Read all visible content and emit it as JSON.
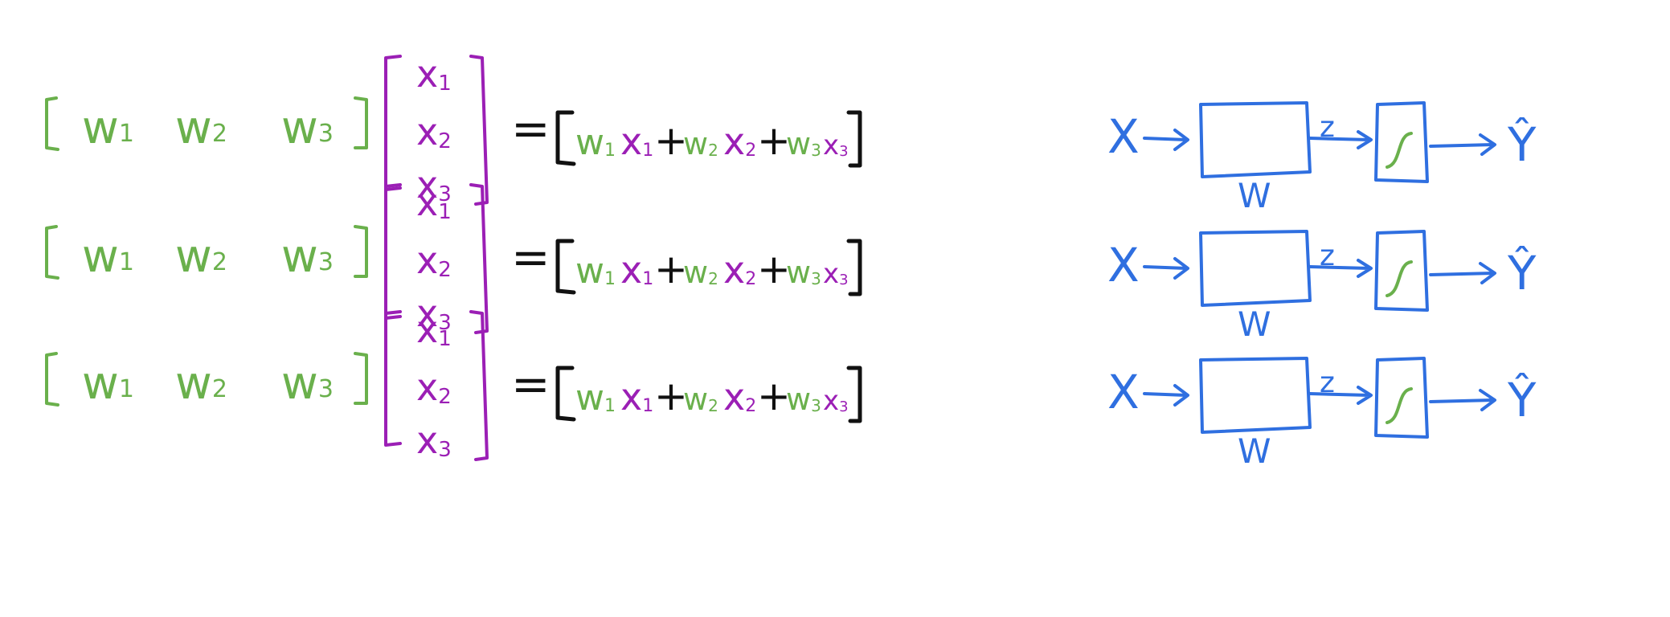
{
  "colors": {
    "weights": "#6ab04c",
    "inputs": "#9b1fb5",
    "operators": "#111111",
    "flow": "#2f6fe0"
  },
  "equation": {
    "w": [
      "w1",
      "w2",
      "w3"
    ],
    "x": [
      "x1",
      "x2",
      "x3"
    ],
    "equals": "=",
    "plus": "+"
  },
  "flow": {
    "input_label": "X",
    "box_label": "W",
    "mid_label": "z",
    "activation_glyph": "sigmoid-curve",
    "output_label": "Ŷ"
  },
  "rows": 3
}
